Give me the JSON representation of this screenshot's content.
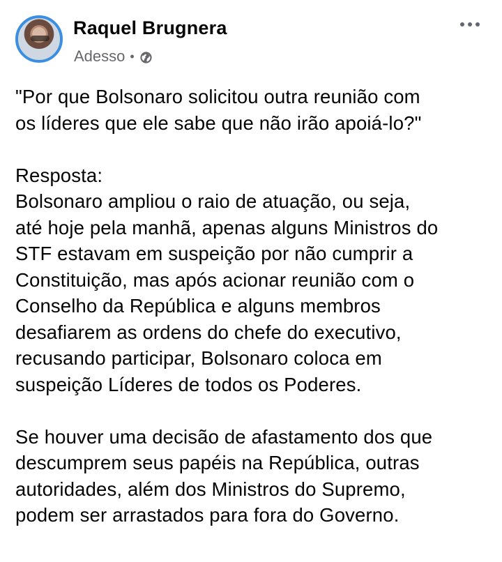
{
  "post": {
    "author": "Raquel Brugnera",
    "meta": "Adesso",
    "separator": "•",
    "privacy_icon": "globe-icon",
    "menu_icon": "more-horizontal-icon"
  },
  "content": {
    "question_lines": [
      "\"Por que Bolsonaro solicitou outra reunião com",
      "os líderes que ele sabe que não irão apoiá-lo?\""
    ],
    "answer_label": "Resposta:",
    "answer_lines": [
      "Bolsonaro ampliou o raio de atuação, ou seja,",
      "até hoje pela manhã, apenas alguns Ministros do",
      "STF estavam em suspeição por não cumprir a",
      "Constituição, mas após acionar reunião com o",
      "Conselho da República e alguns membros",
      "desafiarem as ordens do chefe do executivo,",
      "recusando participar, Bolsonaro coloca em",
      "suspeição Líderes de todos os Poderes."
    ],
    "final_lines": [
      "Se houver uma decisão de afastamento dos que",
      "descumprem seus papéis na República, outras",
      "autoridades, além dos Ministros do Supremo,",
      "podem ser arrastados para fora do Governo."
    ]
  },
  "colors": {
    "avatar_ring": "#3a8fe0",
    "secondary_text": "#65676b",
    "primary_text": "#050505"
  }
}
